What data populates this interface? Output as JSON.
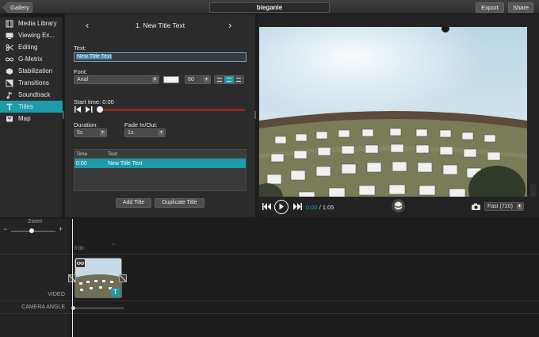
{
  "topbar": {
    "gallery": "Gallery",
    "project_title": "bieganie",
    "export": "Export",
    "share": "Share"
  },
  "sidebar": {
    "items": [
      {
        "label": "Media Library",
        "icon": "film-icon",
        "active": false
      },
      {
        "label": "Viewing Ex...",
        "icon": "monitor-icon",
        "active": false
      },
      {
        "label": "Editing",
        "icon": "scissors-icon",
        "active": false
      },
      {
        "label": "G-Metrix",
        "icon": "infinity-icon",
        "active": false
      },
      {
        "label": "Stabilization",
        "icon": "stabilize-icon",
        "active": false
      },
      {
        "label": "Transitions",
        "icon": "transitions-icon",
        "active": false
      },
      {
        "label": "Soundtrack",
        "icon": "music-note-icon",
        "active": false
      },
      {
        "label": "Titles",
        "icon": "text-t-icon",
        "active": true
      },
      {
        "label": "Map",
        "icon": "map-icon",
        "active": false
      }
    ]
  },
  "panel": {
    "heading": "1. New Title Text",
    "text_label": "Text:",
    "text_value": "New Title Text",
    "font_label": "Font:",
    "font_value": "Arial",
    "font_color": "#f5f5f5",
    "font_size": "60",
    "alignment": "center",
    "start_time_label": "Start time: 0:00",
    "duration_label": "Duration:",
    "duration_value": "5s",
    "fade_label": "Fade In/Out:",
    "fade_value": "1s",
    "table": {
      "headers": [
        "Time",
        "Text"
      ],
      "rows": [
        {
          "time": "0:00",
          "text": "New Title Text"
        }
      ]
    },
    "add_title": "Add Title",
    "duplicate_title": "Duplicate Title"
  },
  "player": {
    "current_time": "0:00",
    "total_time": "/ 1:05",
    "quality": "Fast (720)"
  },
  "timeline": {
    "zoom_label": "Zoom",
    "zoom_minus": "−",
    "zoom_plus": "+",
    "ruler_start": "0:00",
    "track_video": "VIDEO",
    "track_camera": "CAMERA ANGLE",
    "clip_badge": "T"
  },
  "colors": {
    "accent": "#1f9aa8",
    "slider_track": "#8a2a22"
  }
}
